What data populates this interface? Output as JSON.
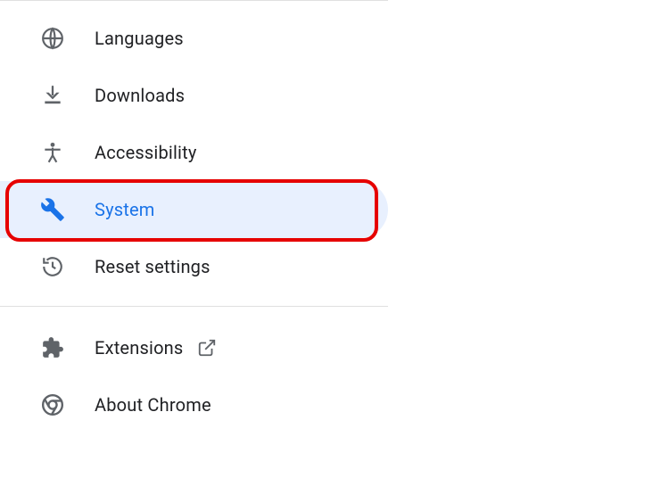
{
  "sidebar": {
    "items": [
      {
        "label": "Languages"
      },
      {
        "label": "Downloads"
      },
      {
        "label": "Accessibility"
      },
      {
        "label": "System"
      },
      {
        "label": "Reset settings"
      },
      {
        "label": "Extensions"
      },
      {
        "label": "About Chrome"
      }
    ]
  }
}
